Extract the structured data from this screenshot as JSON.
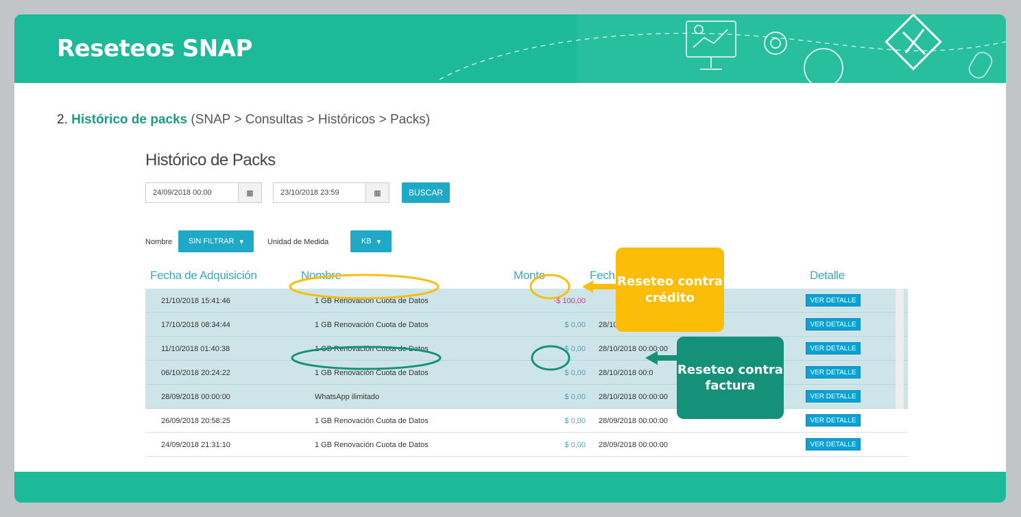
{
  "slide": {
    "title": "Reseteos SNAP",
    "subtitle_num": "2.",
    "subtitle_highlight": "Histórico de packs",
    "subtitle_rest": " (SNAP > Consultas > Históricos > Packs)"
  },
  "screen": {
    "title": "Histórico de Packs",
    "date_from": "24/09/2018 00:00",
    "date_to": "23/10/2018 23:59",
    "calendar_glyph": "▦",
    "search_label": "BUSCAR",
    "name_label": "Nombre",
    "name_filter": "SIN FILTRAR",
    "unit_label": "Unidad de Medida",
    "unit_value": "KB",
    "caret": "▾",
    "columns": [
      "Fecha de Adquisición",
      "Nombre",
      "Monto",
      "Fech",
      "Detalle"
    ],
    "detail_label": "VER DETALLE",
    "rows": [
      {
        "date": "21/10/2018 15:41:46",
        "name": "1 GB Renovación Cuota de Datos",
        "amount": "-$ 100,00",
        "expiry": "",
        "highlight": true
      },
      {
        "date": "17/10/2018 08:34:44",
        "name": "1 GB Renovación Cuota de Datos",
        "amount": "$ 0,00",
        "expiry": "28/10/20",
        "highlight": true
      },
      {
        "date": "11/10/2018 01:40:38",
        "name": "1 GB Renovación Cuota de Datos",
        "amount": "$ 0,00",
        "expiry": "28/10/2018 00:00:00",
        "highlight": true
      },
      {
        "date": "06/10/2018 20:24:22",
        "name": "1 GB Renovación Cuota de Datos",
        "amount": "$ 0,00",
        "expiry": "28/10/2018 00:0",
        "highlight": true
      },
      {
        "date": "28/09/2018 00:00:00",
        "name": "WhatsApp ilimitado",
        "amount": "$ 0,00",
        "expiry": "28/10/2018 00:00:00",
        "highlight": true
      },
      {
        "date": "26/09/2018 20:58:25",
        "name": "1 GB Renovación Cuota de Datos",
        "amount": "$ 0,00",
        "expiry": "28/09/2018 00:00:00",
        "highlight": false
      },
      {
        "date": "24/09/2018 21:31:10",
        "name": "1 GB Renovación Cuota de Datos",
        "amount": "$ 0,00",
        "expiry": "28/09/2018 00:00:00",
        "highlight": false
      }
    ]
  },
  "callouts": {
    "credit": "Reseteo contra crédito",
    "invoice": "Reseteo contra factura"
  },
  "colors": {
    "brand": "#1cba98",
    "accent_blue": "#1fa9c7",
    "yellow": "#fbbd08",
    "dark_green": "#159079",
    "negative": "#d0348b"
  }
}
